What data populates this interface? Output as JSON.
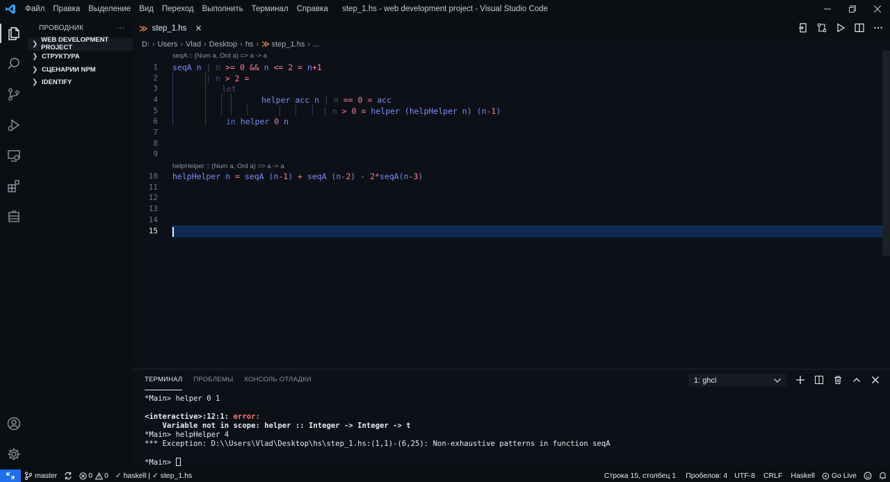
{
  "window": {
    "title": "step_1.hs - web development project - Visual Studio Code",
    "menu": [
      "Файл",
      "Правка",
      "Выделение",
      "Вид",
      "Переход",
      "Выполнить",
      "Терминал",
      "Справка"
    ]
  },
  "sidebar": {
    "title": "ПРОВОДНИК",
    "more": "···",
    "sections": [
      "WEB DEVELOPMENT PROJECT",
      "СТРУКТУРА",
      "СЦЕНАРИИ NPM",
      "IDENTIFY"
    ]
  },
  "editor": {
    "tab": {
      "name": "step_1.hs",
      "close": "✕",
      "icon_text": "≫"
    },
    "breadcrumb": [
      "D:",
      "Users",
      "Vlad",
      "Desktop",
      "hs",
      "step_1.hs",
      "..."
    ],
    "lens": [
      "seqA :: (Num a, Ord a) => a -> a",
      "helpHelper :: (Num a, Ord a) => a -> a"
    ],
    "line_numbers": [
      "1",
      "2",
      "3",
      "4",
      "5",
      "6",
      "7",
      "8",
      "9",
      "10",
      "11",
      "12",
      "13",
      "14",
      "15"
    ],
    "code": {
      "l1": {
        "a": "seqA n ",
        "b": "| n ",
        "c": ">=",
        "d": " ",
        "e": "0",
        "f": " ",
        "g": "&&",
        "h": " n ",
        "i": "<=",
        "j": " ",
        "k": "2",
        "l": " ",
        "m": "=",
        "n": " n",
        "o": "+",
        "p": "1"
      },
      "l2": {
        "a": "| n ",
        "b": ">",
        "c": " ",
        "d": "2",
        "e": " ",
        "f": "="
      },
      "l3": {
        "a": "let"
      },
      "l4": {
        "a": "helper acc n ",
        "b": "| n ",
        "c": "==",
        "d": " ",
        "e": "0",
        "f": " ",
        "g": "=",
        "h": " acc"
      },
      "l5": {
        "a": "| n ",
        "b": ">",
        "c": " ",
        "d": "0",
        "e": " ",
        "f": "=",
        "g": " helper (helpHelper n) (n",
        "h": "-",
        "i": "1",
        "j": ")"
      },
      "l6": {
        "a": "in",
        "b": " helper ",
        "c": "0",
        "d": " n"
      },
      "l10": {
        "a": "helpHelper n ",
        "b": "=",
        "c": " seqA (n",
        "d": "-",
        "e": "1",
        "f": ") ",
        "g": "+",
        "h": " seqA (n",
        "i": "-",
        "j": "2",
        "k": ") ",
        "l": "-",
        "m": " ",
        "n": "2",
        "o": "*",
        "p": "seqA(n",
        "q": "-",
        "r": "3",
        "s": ")"
      }
    }
  },
  "panel": {
    "tabs": [
      "ТЕРМИНАЛ",
      "ПРОБЛЕМЫ",
      "КОНСОЛЬ ОТЛАДКИ"
    ],
    "terminal_select": "1: ghci",
    "lines": {
      "t1": "*Main> helper 0 1",
      "t2a": "<interactive>:12:1: ",
      "t2b": "error:",
      "t3": "    Variable not in scope: helper :: Integer -> Integer -> t",
      "t4": "*Main> helpHelper 4",
      "t5": "*** Exception: D:\\\\Users\\Vlad\\Desktop\\hs\\step_1.hs:(1,1)-(6,25): Non-exhaustive patterns in function seqA",
      "t6": "*Main> "
    }
  },
  "status": {
    "branch": "master",
    "errors": "0",
    "warnings": "0",
    "haskell": "haskell |",
    "file": "step_1.hs",
    "position": "Строка 15, столбец 1",
    "spaces": "Пробелов: 4",
    "encoding": "UTF-8",
    "eol": "CRLF",
    "language": "Haskell",
    "golive": "Go Live"
  },
  "colors": {
    "accent": "#1f6feb",
    "keyword": "#5c74e8",
    "number": "#ff7b9c",
    "identifier": "#7c8cf8",
    "haskell_icon": "#f0883e"
  }
}
